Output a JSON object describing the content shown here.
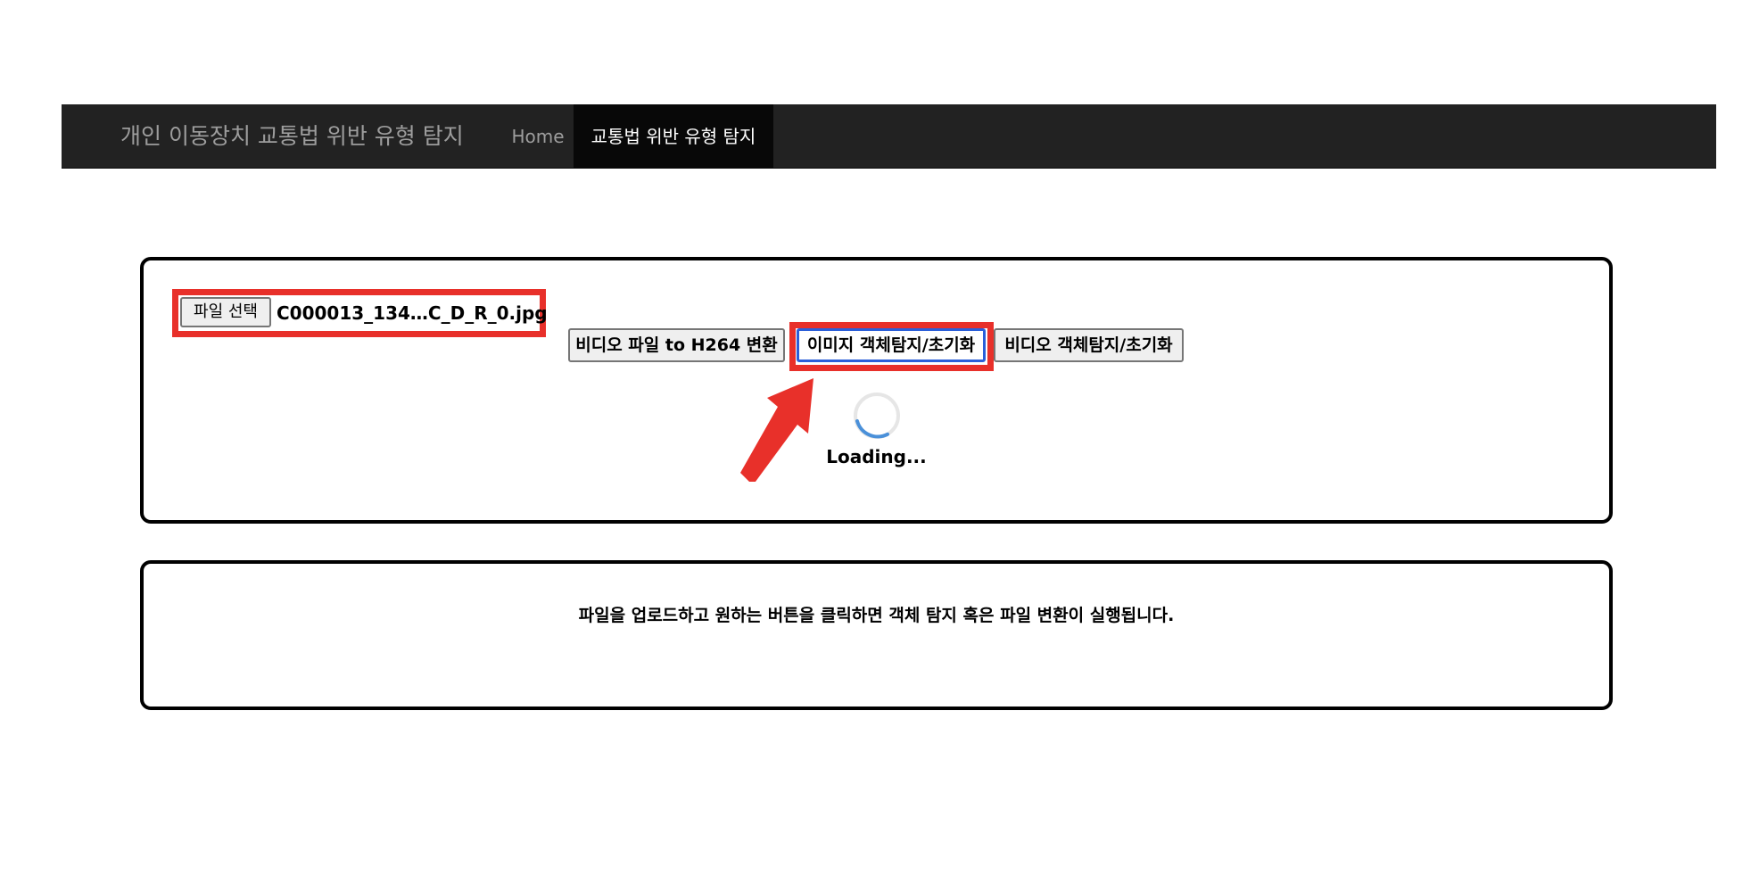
{
  "navbar": {
    "brand": "개인 이동장치 교통법 위반 유형 탐지",
    "items": [
      {
        "label": "Home",
        "active": false
      },
      {
        "label": "교통법 위반 유형 탐지",
        "active": true
      }
    ],
    "background": "#222222"
  },
  "upload": {
    "choose_file_label": "파일 선택",
    "file_name": "C000013_134…C_D_R_0.jpg"
  },
  "actions": {
    "convert_h264_label": "비디오 파일 to H264 변환",
    "image_detect_label": "이미지 객체탐지/초기화",
    "video_detect_label": "비디오 객체탐지/초기화"
  },
  "status": {
    "loading_text": "Loading..."
  },
  "result": {
    "message": "파일을 업로드하고 원하는 버튼을 클릭하면 객체 탐지 혹은 파일 변환이 실행됩니다."
  },
  "colors": {
    "highlight": "#e8302a",
    "focus_ring": "#2b5fd9",
    "spinner": "#4a90d9"
  },
  "icons": {
    "arrow": "annotation-arrow-icon",
    "spinner": "loading-spinner-icon"
  }
}
